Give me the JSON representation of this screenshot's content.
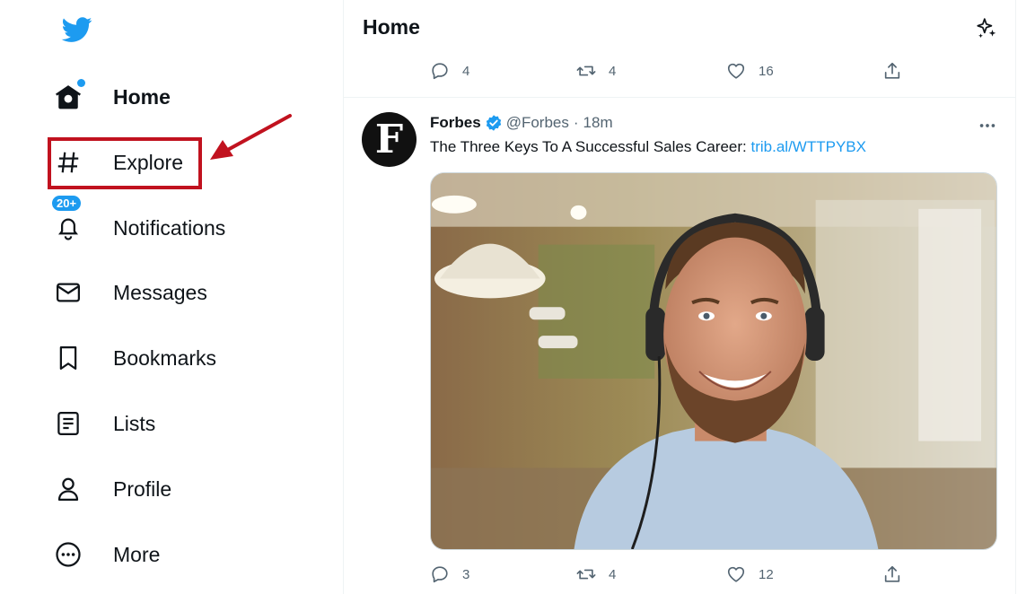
{
  "sidebar": {
    "items": [
      {
        "label": "Home",
        "icon": "home-icon"
      },
      {
        "label": "Explore",
        "icon": "hashtag-icon"
      },
      {
        "label": "Notifications",
        "icon": "bell-icon",
        "badge": "20+"
      },
      {
        "label": "Messages",
        "icon": "envelope-icon"
      },
      {
        "label": "Bookmarks",
        "icon": "bookmark-icon"
      },
      {
        "label": "Lists",
        "icon": "list-icon"
      },
      {
        "label": "Profile",
        "icon": "person-icon"
      },
      {
        "label": "More",
        "icon": "more-circle-icon"
      }
    ]
  },
  "feed": {
    "title": "Home",
    "prev_tweet_actions": {
      "replies": "4",
      "retweets": "4",
      "likes": "16"
    },
    "tweet": {
      "author": "Forbes",
      "handle": "@Forbes",
      "separator": "·",
      "time": "18m",
      "text": "The Three Keys To A Successful Sales Career: ",
      "link": "trib.al/WTTPYBX",
      "avatar_letter": "F",
      "actions": {
        "replies": "3",
        "retweets": "4",
        "likes": "12"
      }
    }
  },
  "colors": {
    "accent": "#1d9bf0",
    "annotation": "#c1121f"
  }
}
